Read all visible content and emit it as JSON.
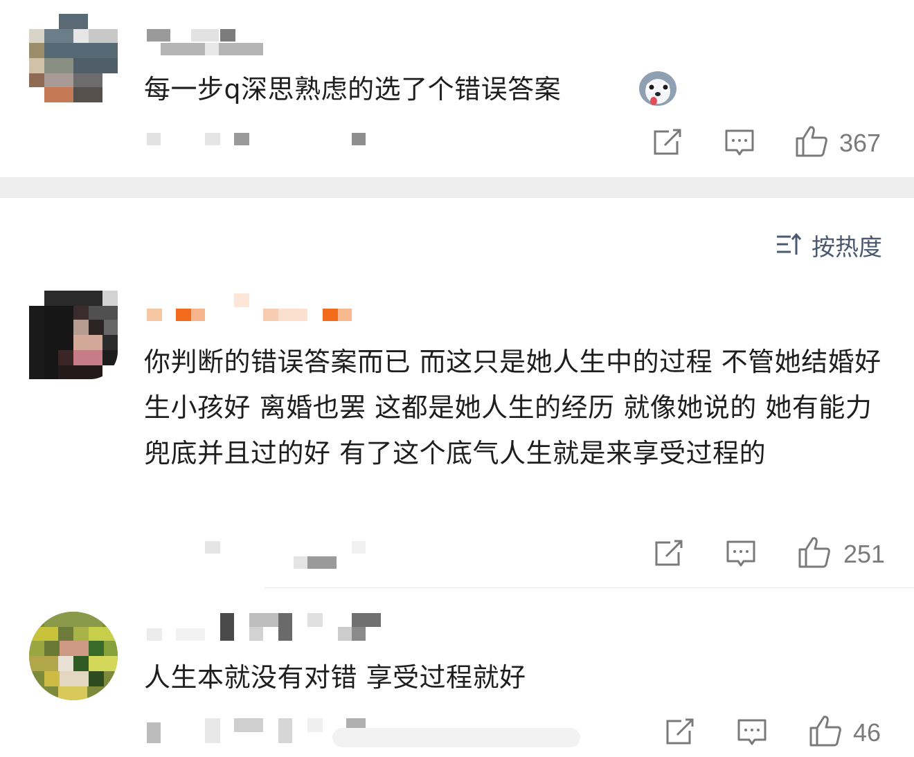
{
  "comments": [
    {
      "text": "每一步q深思熟虑的选了个错误答案",
      "emoji": "dog-face-emoji",
      "likes": "367"
    },
    {
      "text": "你判断的错误答案而已 而这只是她人生中的过程 不管她结婚好 生小孩好 离婚也罢 这都是她人生的经历 就像她说的 她有能力兜底并且过的好 有了这个底气人生就是来享受过程的",
      "likes": "251"
    },
    {
      "text": "人生本就没有对错 享受过程就好",
      "likes": "46"
    }
  ],
  "sort": {
    "label": "按热度"
  },
  "colors": {
    "divider": "#eeeeee",
    "icon": "#7a7a7a",
    "sort": "#4a5870",
    "orange_name": "#f26b1d"
  }
}
